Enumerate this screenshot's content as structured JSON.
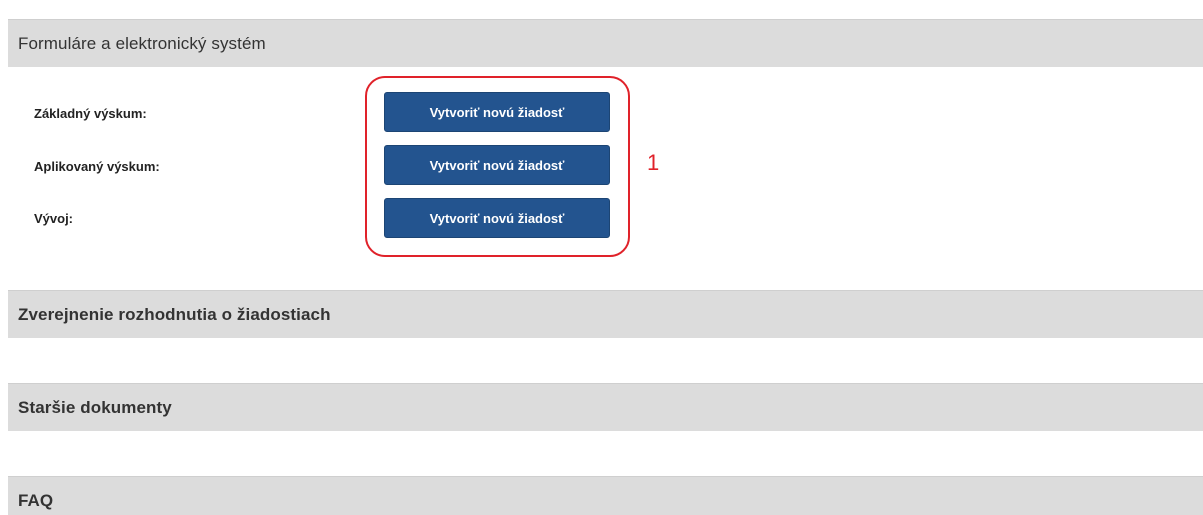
{
  "sections": {
    "forms": {
      "title": "Formuláre a elektronický systém"
    },
    "decisions": {
      "title": "Zverejnenie rozhodnutia o žiadostiach"
    },
    "older_docs": {
      "title": "Staršie dokumenty"
    },
    "faq": {
      "title": "FAQ"
    }
  },
  "forms": {
    "rows": [
      {
        "label": "Základný výskum:",
        "button": "Vytvoriť novú žiadosť"
      },
      {
        "label": "Aplikovaný výskum:",
        "button": "Vytvoriť novú žiadosť"
      },
      {
        "label": "Vývoj:",
        "button": "Vytvoriť novú žiadosť"
      }
    ]
  },
  "annotation": {
    "number": "1"
  },
  "colors": {
    "button_bg": "#23548f",
    "header_bg": "#dcdcdc",
    "annotation": "#e0222a"
  }
}
